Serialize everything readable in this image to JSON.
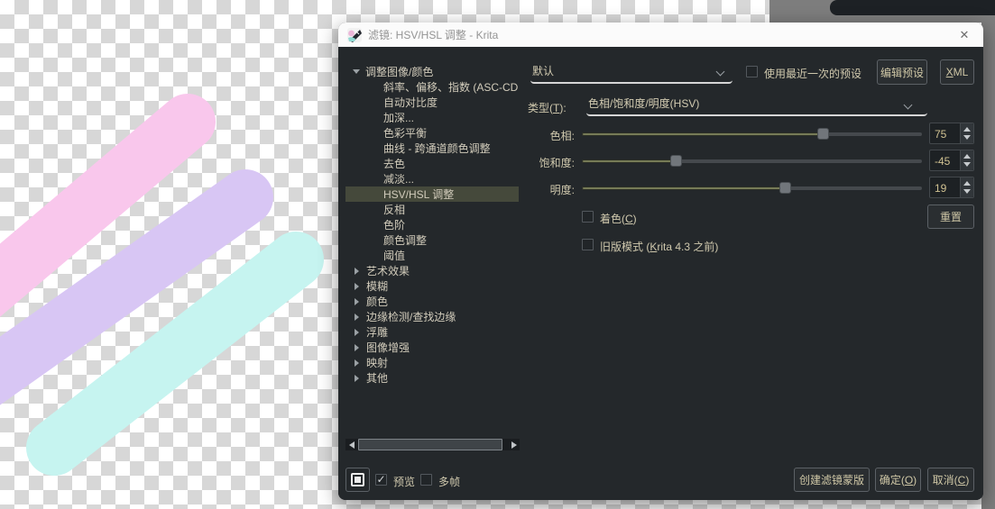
{
  "window": {
    "title": "滤镜: HSV/HSL 调整 - Krita",
    "close_glyph": "✕"
  },
  "preset_row": {
    "preset_value": "默认",
    "use_last_preset_label": "使用最近一次的预设",
    "edit_preset_button": "编辑预设",
    "xml_button": {
      "pre": "",
      "key": "X",
      "post": "ML"
    }
  },
  "type_row": {
    "label": {
      "pre": "类型(",
      "key": "T",
      "post": "):"
    },
    "value": "色相/饱和度/明度(HSV)"
  },
  "sliders": [
    {
      "label": "色相:",
      "value": "75",
      "percent": 70.8
    },
    {
      "label": "饱和度:",
      "value": "-45",
      "percent": 27.5
    },
    {
      "label": "明度:",
      "value": "19",
      "percent": 59.6
    }
  ],
  "reset_button": "重置",
  "options": {
    "colorize": {
      "pre": "着色(",
      "key": "C",
      "post": ")"
    },
    "legacy": {
      "pre": "旧版模式 (",
      "key": "K",
      "post": "rita 4.3 之前)"
    }
  },
  "tree": {
    "items": [
      {
        "label": "调整图像/颜色",
        "level": 0,
        "state": "expanded"
      },
      {
        "label": "斜率、偏移、指数 (ASC-CD",
        "level": 1
      },
      {
        "label": "自动对比度",
        "level": 1
      },
      {
        "label": "加深...",
        "level": 1
      },
      {
        "label": "色彩平衡",
        "level": 1
      },
      {
        "label": "曲线 - 跨通道颜色调整",
        "level": 1
      },
      {
        "label": "去色",
        "level": 1
      },
      {
        "label": "减淡...",
        "level": 1
      },
      {
        "label": "HSV/HSL 调整",
        "level": 1,
        "selected": true
      },
      {
        "label": "反相",
        "level": 1
      },
      {
        "label": "色阶",
        "level": 1
      },
      {
        "label": "颜色调整",
        "level": 1
      },
      {
        "label": "阈值",
        "level": 1
      },
      {
        "label": "艺术效果",
        "level": 0,
        "state": "collapsed"
      },
      {
        "label": "模糊",
        "level": 0,
        "state": "collapsed"
      },
      {
        "label": "颜色",
        "level": 0,
        "state": "collapsed"
      },
      {
        "label": "边缘检测/查找边缘",
        "level": 0,
        "state": "collapsed"
      },
      {
        "label": "浮雕",
        "level": 0,
        "state": "collapsed"
      },
      {
        "label": "图像增强",
        "level": 0,
        "state": "collapsed"
      },
      {
        "label": "映射",
        "level": 0,
        "state": "collapsed"
      },
      {
        "label": "其他",
        "level": 0,
        "state": "collapsed"
      }
    ]
  },
  "footer": {
    "preview_label": "预览",
    "preview_checked": true,
    "multiframe_label": "多帧",
    "checkmark_glyph": "✓",
    "create_mask_button": "创建滤镜蒙版",
    "ok_button": {
      "pre": "确定(",
      "key": "O",
      "post": ")"
    },
    "cancel_button": {
      "pre": "取消(",
      "key": "C",
      "post": ")"
    }
  },
  "colors": {
    "dialog_bg": "#24282b",
    "titlebar_bg": "#fbfbfb",
    "selected_row_bg": "#45493b",
    "text": "#cfc8ad",
    "value_text": "#d1c292",
    "slider_fill": "#767b57",
    "app_bg": "#7d7d7d",
    "top_bar": "#1d2125",
    "stroke_pink": "#f9c7ec",
    "stroke_lavender": "#d8c6f4",
    "stroke_cyan": "#c6f4f0"
  }
}
